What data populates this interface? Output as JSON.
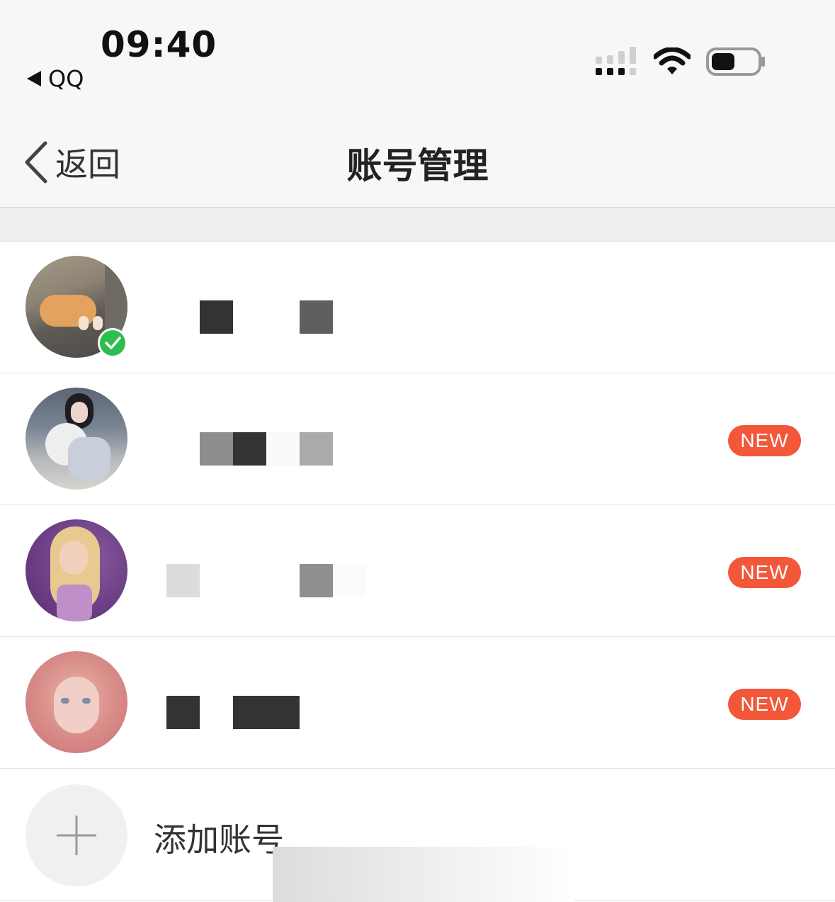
{
  "status_bar": {
    "time": "09:40",
    "back_app": "QQ",
    "icons": [
      "cellular-signal-icon",
      "wifi-icon",
      "battery-icon"
    ]
  },
  "nav": {
    "back_label": "返回",
    "title": "账号管理"
  },
  "accounts": [
    {
      "badge": "",
      "current": true
    },
    {
      "badge": "NEW",
      "current": false
    },
    {
      "badge": "NEW",
      "current": false
    },
    {
      "badge": "NEW",
      "current": false
    }
  ],
  "add_account": {
    "label": "添加账号"
  },
  "colors": {
    "badge": "#f2573a",
    "check": "#2dbe4d",
    "nav_bg": "#f7f7f7"
  }
}
